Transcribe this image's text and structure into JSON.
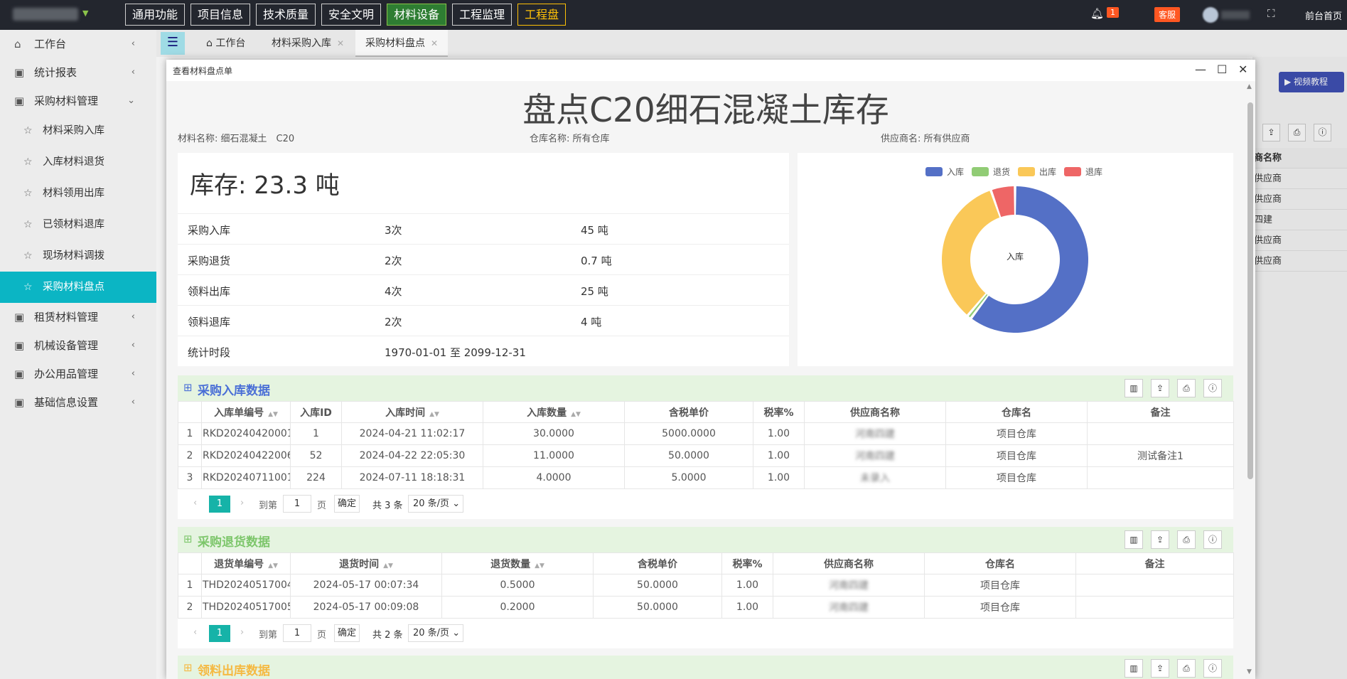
{
  "topnav": [
    "通用功能",
    "项目信息",
    "技术质量",
    "安全文明",
    "材料设备",
    "工程监理",
    "工程盘"
  ],
  "header": {
    "notifications": "1",
    "service": "客服",
    "front_link": "前台首页"
  },
  "sidebar": {
    "items_top": [
      {
        "label": "工作台",
        "arrow": "<"
      },
      {
        "label": "统计报表",
        "arrow": "<"
      },
      {
        "label": "采购材料管理",
        "arrow": "v"
      }
    ],
    "sub_items": [
      "材料采购入库",
      "入库材料退货",
      "材料领用出库",
      "已领材料退库",
      "现场材料调拨",
      "采购材料盘点"
    ],
    "items_bottom": [
      {
        "label": "租赁材料管理",
        "arrow": "<"
      },
      {
        "label": "机械设备管理",
        "arrow": "<"
      },
      {
        "label": "办公用品管理",
        "arrow": "<"
      },
      {
        "label": "基础信息设置",
        "arrow": "<"
      }
    ]
  },
  "tabs": {
    "home": "工作台",
    "t1": "材料采购入库",
    "t2": "采购材料盘点"
  },
  "background_page": {
    "video_button": "视频教程",
    "column_header": "商名称",
    "rows": [
      "供应商",
      "供应商",
      "四建",
      "供应商",
      "供应商"
    ]
  },
  "modal": {
    "title": "查看材料盘点单",
    "heading": "盘点C20细石混凝土库存",
    "material_label": "材料名称:",
    "material_value": "细石混凝土　C20",
    "warehouse_label": "仓库名称:",
    "warehouse_value": "所有仓库",
    "supplier_label": "供应商名:",
    "supplier_value": "所有供应商",
    "stock": "库存: 23.3 吨",
    "summary": [
      {
        "name": "采购入库",
        "count": "3次",
        "qty": "45 吨"
      },
      {
        "name": "采购退货",
        "count": "2次",
        "qty": "0.7 吨"
      },
      {
        "name": "领料出库",
        "count": "4次",
        "qty": "25 吨"
      },
      {
        "name": "领料退库",
        "count": "2次",
        "qty": "4 吨"
      }
    ],
    "period_label": "统计时段",
    "period_value": "1970-01-01 至 2099-12-31"
  },
  "chart_data": {
    "type": "pie",
    "style": "donut",
    "center_label": "入库",
    "legend_position": "top",
    "categories": [
      "入库",
      "退货",
      "出库",
      "退库"
    ],
    "values": [
      45,
      0.7,
      25,
      4
    ],
    "colors": [
      "#5470c6",
      "#91cc75",
      "#fac858",
      "#ee6666"
    ]
  },
  "purchase_in": {
    "title": "采购入库数据",
    "title_color": "#4a6fd6",
    "columns": [
      "",
      "入库单编号",
      "入库ID",
      "入库时间",
      "入库数量",
      "含税单价",
      "税率%",
      "供应商名称",
      "仓库名",
      "备注"
    ],
    "rows": [
      [
        "1",
        "RKD20240420001",
        "1",
        "2024-04-21 11:02:17",
        "30.0000",
        "5000.0000",
        "1.00",
        "河南四建",
        "项目仓库",
        ""
      ],
      [
        "2",
        "RKD20240422006",
        "52",
        "2024-04-22 22:05:30",
        "11.0000",
        "50.0000",
        "1.00",
        "河南四建",
        "项目仓库",
        "测试备注1"
      ],
      [
        "3",
        "RKD20240711001",
        "224",
        "2024-07-11 18:18:31",
        "4.0000",
        "5.0000",
        "1.00",
        "未录入",
        "项目仓库",
        ""
      ]
    ],
    "pager": {
      "current": "1",
      "goto": "到第",
      "input": "1",
      "page": "页",
      "ok": "确定",
      "total": "共 3 条",
      "size": "20 条/页"
    }
  },
  "purchase_return": {
    "title": "采购退货数据",
    "title_color": "#7dc66b",
    "columns": [
      "",
      "退货单编号",
      "退货时间",
      "退货数量",
      "含税单价",
      "税率%",
      "供应商名称",
      "仓库名",
      "备注"
    ],
    "rows": [
      [
        "1",
        "THD20240517004",
        "2024-05-17 00:07:34",
        "0.5000",
        "50.0000",
        "1.00",
        "河南四建",
        "项目仓库",
        ""
      ],
      [
        "2",
        "THD20240517005",
        "2024-05-17 00:09:08",
        "0.2000",
        "50.0000",
        "1.00",
        "河南四建",
        "项目仓库",
        ""
      ]
    ],
    "pager": {
      "current": "1",
      "goto": "到第",
      "input": "1",
      "page": "页",
      "ok": "确定",
      "total": "共 2 条",
      "size": "20 条/页"
    }
  },
  "material_out": {
    "title": "领料出库数据",
    "title_color": "#f5b942"
  }
}
